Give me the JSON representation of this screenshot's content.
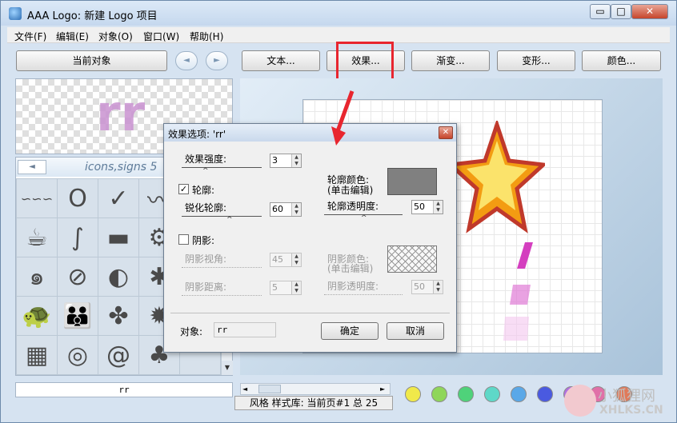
{
  "window": {
    "title": "AAA Logo: 新建 Logo 项目",
    "min_label": "▭",
    "max_label": "□",
    "close_label": "✕"
  },
  "menu": [
    "文件(F)",
    "编辑(E)",
    "对象(O)",
    "窗口(W)",
    "帮助(H)"
  ],
  "toolbar": {
    "current_object": "当前对象",
    "prev": "◄",
    "next": "►",
    "text": "文本...",
    "effect": "效果...",
    "gradient": "渐变...",
    "transform": "变形...",
    "color": "颜色..."
  },
  "preview": {
    "text": "rr"
  },
  "gallery": {
    "title": "icons,signs 5",
    "left_arrow": "◄",
    "down_arrow": "▼",
    "icons": [
      "∽∽∽",
      "Ο",
      "✓",
      "〰",
      "",
      "☕",
      "∫",
      "▬",
      "⚙",
      "",
      "๑",
      "⊘",
      "◐",
      "✱",
      "",
      "🐢",
      "👪",
      "✤",
      "✹",
      "",
      "▦",
      "◎",
      "@",
      "♣",
      ""
    ]
  },
  "object_name": "rr",
  "status": "风格 样式库: 当前页#1 总 25",
  "palette": [
    "#f0e94a",
    "#8fd65a",
    "#4fd27a",
    "#5ed8c8",
    "#5aa8e8",
    "#4a5ae0",
    "#b070e0",
    "#e070a8",
    "#e07a5a"
  ],
  "watermark": {
    "line1": "小狐狸网",
    "line2": "XHLKS.CN"
  },
  "dialog": {
    "title": "效果选项: 'rr'",
    "close": "✕",
    "effect_strength_label": "效果强度:",
    "effect_strength_value": "3",
    "outline_check_label": "轮廓:",
    "outline_checked": "✓",
    "sharpen_label": "锐化轮廓:",
    "sharpen_value": "60",
    "outline_color_label": "轮廓颜色:",
    "outline_color_hint": "(单击编辑)",
    "outline_opacity_label": "轮廓透明度:",
    "outline_opacity_value": "50",
    "outline_color": "#808080",
    "shadow_check_label": "阴影:",
    "shadow_angle_label": "阴影视角:",
    "shadow_angle_value": "45",
    "shadow_distance_label": "阴影距离:",
    "shadow_distance_value": "5",
    "shadow_color_label": "阴影颜色:",
    "shadow_color_hint": "(单击编辑)",
    "shadow_opacity_label": "阴影透明度:",
    "shadow_opacity_value": "50",
    "object_label": "对象:",
    "object_value": "rr",
    "ok": "确定",
    "cancel": "取消",
    "thumb": "^"
  }
}
